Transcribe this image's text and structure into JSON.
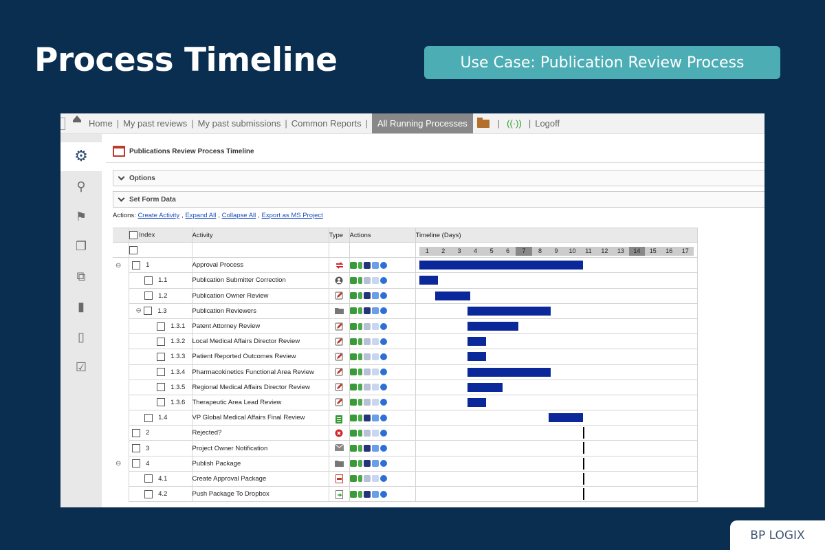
{
  "slide": {
    "title": "Process Timeline",
    "use_case": "Use Case: Publication Review Process",
    "logo_text": "BP LOGIX"
  },
  "nav": {
    "items": [
      "Home",
      "My past reviews",
      "My past submissions",
      "Common Reports"
    ],
    "active": "All Running Processes",
    "logoff": "Logoff"
  },
  "panel": {
    "title": "Publications Review Process Timeline",
    "options": "Options",
    "set_form_data": "Set Form Data",
    "actions_label": "Actions:",
    "actions": [
      "Create Activity",
      "Expand All",
      "Collapse All",
      "Export as MS Project"
    ]
  },
  "table": {
    "headers": {
      "index": "Index",
      "activity": "Activity",
      "type": "Type",
      "actions": "Actions",
      "timeline": "Timeline (Days)"
    },
    "days": [
      "1",
      "2",
      "3",
      "4",
      "5",
      "6",
      "7",
      "8",
      "9",
      "10",
      "11",
      "12",
      "13",
      "14",
      "15",
      "16",
      "17"
    ],
    "weekend_days": [
      "7",
      "14"
    ],
    "rows": [
      {
        "level": 0,
        "expander": true,
        "index": "1",
        "name": "Approval Process",
        "type": "loop",
        "start": 1,
        "end": 11
      },
      {
        "level": 1,
        "expander": false,
        "index": "1.1",
        "name": "Publication Submitter Correction",
        "type": "user",
        "start": 1,
        "end": 2
      },
      {
        "level": 1,
        "expander": false,
        "index": "1.2",
        "name": "Publication Owner Review",
        "type": "form",
        "start": 2,
        "end": 4
      },
      {
        "level": 1,
        "expander": true,
        "index": "1.3",
        "name": "Publication Reviewers",
        "type": "folder",
        "start": 4,
        "end": 9
      },
      {
        "level": 2,
        "expander": false,
        "index": "1.3.1",
        "name": "Patent Attorney Review",
        "type": "form",
        "start": 4,
        "end": 7
      },
      {
        "level": 2,
        "expander": false,
        "index": "1.3.2",
        "name": "Local Medical Affairs Director Review",
        "type": "form",
        "start": 4,
        "end": 5
      },
      {
        "level": 2,
        "expander": false,
        "index": "1.3.3",
        "name": "Patient Reported Outcomes Review",
        "type": "form",
        "start": 4,
        "end": 5
      },
      {
        "level": 2,
        "expander": false,
        "index": "1.3.4",
        "name": "Pharmacokinetics Functional Area Review",
        "type": "form",
        "start": 4,
        "end": 9
      },
      {
        "level": 2,
        "expander": false,
        "index": "1.3.5",
        "name": "Regional Medical Affairs Director Review",
        "type": "form",
        "start": 4,
        "end": 6
      },
      {
        "level": 2,
        "expander": false,
        "index": "1.3.6",
        "name": "Therapeutic Area Lead Review",
        "type": "form",
        "start": 4,
        "end": 5
      },
      {
        "level": 1,
        "expander": false,
        "index": "1.4",
        "name": "VP Global Medical Affairs Final Review",
        "type": "clipboard",
        "start": 9,
        "end": 11
      },
      {
        "level": 0,
        "expander": false,
        "index": "2",
        "name": "Rejected?",
        "type": "reject",
        "milestone": 11
      },
      {
        "level": 0,
        "expander": false,
        "index": "3",
        "name": "Project Owner Notification",
        "type": "mail",
        "milestone": 11
      },
      {
        "level": 0,
        "expander": true,
        "index": "4",
        "name": "Publish Package",
        "type": "folder",
        "milestone": 11
      },
      {
        "level": 1,
        "expander": false,
        "index": "4.1",
        "name": "Create Approval Package",
        "type": "pdf",
        "milestone": 11
      },
      {
        "level": 1,
        "expander": false,
        "index": "4.2",
        "name": "Push Package To Dropbox",
        "type": "export",
        "milestone": 11
      }
    ]
  },
  "colors": {
    "bar": "#0a2899",
    "background": "#0a2e50",
    "accent": "#4cadb4"
  }
}
